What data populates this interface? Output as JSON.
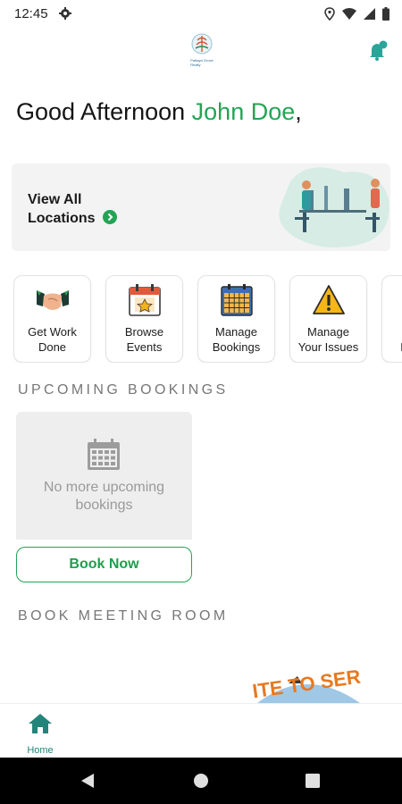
{
  "status_bar": {
    "time": "12:45",
    "icons": [
      "gear-icon",
      "location-icon",
      "wifi-icon",
      "signal-icon",
      "battery-icon"
    ]
  },
  "header": {
    "logo_icon": "company-logo",
    "logo_text": "Pattaya Grove Realty",
    "notification_icon": "bell-icon"
  },
  "greeting": {
    "prefix": "Good Afternoon ",
    "name": "John Doe",
    "suffix": ","
  },
  "locations_card": {
    "title_line1": "View All",
    "title_line2": "Locations",
    "arrow_icon": "chevron-right-circle-icon"
  },
  "quick_actions": [
    {
      "line1": "Get Work",
      "line2": "Done",
      "icon": "handshake-icon"
    },
    {
      "line1": "Browse",
      "line2": "Events",
      "icon": "event-calendar-icon"
    },
    {
      "line1": "Manage",
      "line2": "Bookings",
      "icon": "bookings-calendar-icon"
    },
    {
      "line1": "Manage",
      "line2": "Your Issues",
      "icon": "warning-icon"
    },
    {
      "line1": "M",
      "line2": "Do",
      "icon": "document-icon"
    }
  ],
  "upcoming": {
    "title": "UPCOMING BOOKINGS",
    "empty_line1": "No more upcoming",
    "empty_line2": "bookings",
    "book_now": "Book Now"
  },
  "meeting_room": {
    "title": "BOOK MEETING ROOM",
    "banner_text": "ITE TO SER"
  },
  "bottom_nav": {
    "home_label": "Home",
    "home_icon": "home-icon"
  },
  "system_nav": [
    "back-icon",
    "home-circle-icon",
    "recents-icon"
  ],
  "colors": {
    "accent_green": "#23a455",
    "teal": "#23857a",
    "section_gray": "#777777",
    "banner_orange": "#e8791f"
  }
}
